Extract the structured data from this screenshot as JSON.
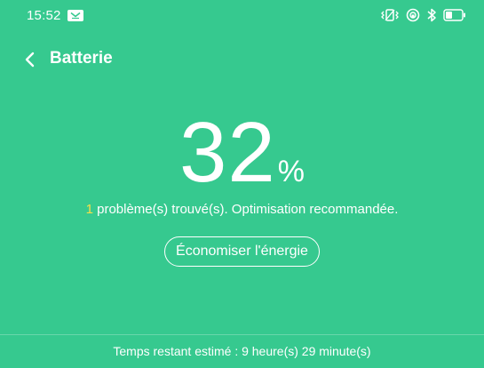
{
  "status_bar": {
    "time": "15:52",
    "icons": [
      "message-icon",
      "vibrate-icon",
      "hotspot-icon",
      "bluetooth-icon",
      "battery-icon"
    ]
  },
  "header": {
    "back_icon": "chevron-left-icon",
    "title": "Batterie"
  },
  "battery": {
    "level": 32,
    "level_text": "32",
    "percent_sign": "%"
  },
  "problem": {
    "count": "1",
    "text": " problème(s) trouvé(s). Optimisation recommandée."
  },
  "save_button": {
    "label": "Économiser l'énergie"
  },
  "footer": {
    "estimate": "Temps restant estimé : 9 heure(s) 29 minute(s)"
  },
  "colors": {
    "background": "#36c98f",
    "text": "#ffffff",
    "problem_count": "#f4e04a"
  }
}
